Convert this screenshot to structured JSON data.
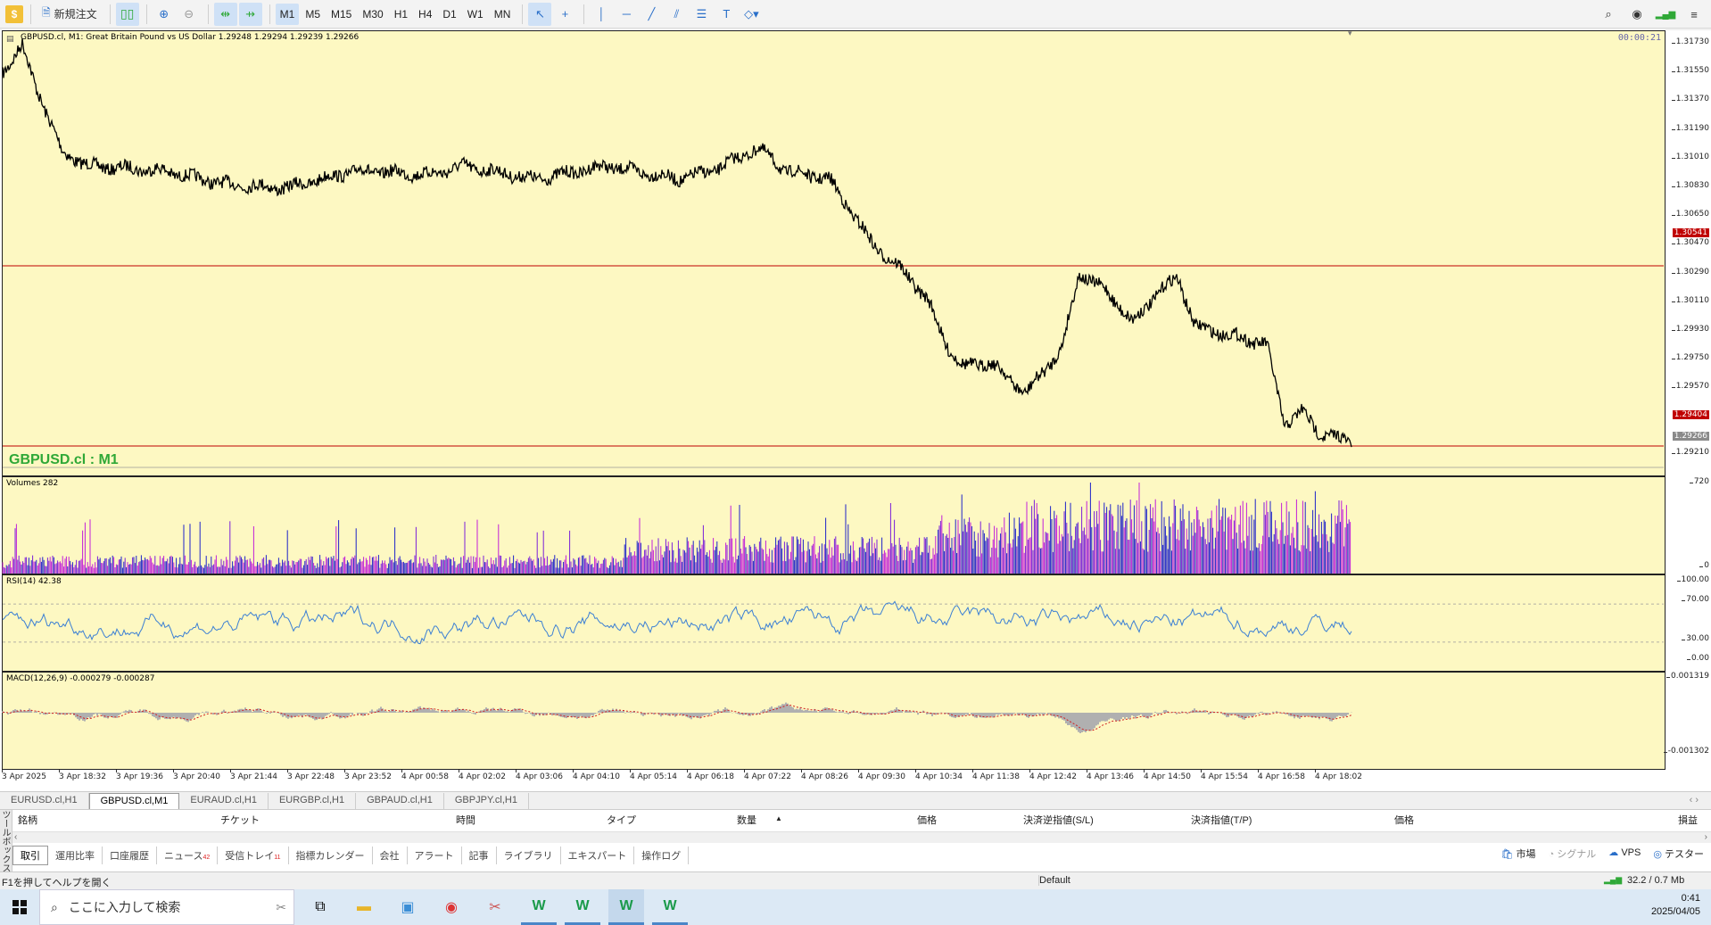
{
  "toolbar": {
    "new_order_label": "新規注文",
    "timeframes": [
      "M1",
      "M5",
      "M15",
      "M30",
      "H1",
      "H4",
      "D1",
      "W1",
      "MN"
    ],
    "active_timeframe": "M1"
  },
  "chart": {
    "title": "GBPUSD.cl, M1:  Great Britain Pound vs US Dollar  1.29248 1.29294 1.29239 1.29266",
    "symbol_label": "GBPUSD.cl : M1",
    "countdown": "00:00:21",
    "background_color": "#fdf8c2",
    "price_axis": [
      "1.31730",
      "1.31550",
      "1.31370",
      "1.31190",
      "1.31010",
      "1.30830",
      "1.30650",
      "1.30470",
      "1.30290",
      "1.30110",
      "1.29930",
      "1.29750",
      "1.29570",
      "1.29210"
    ],
    "price_tags": {
      "upper_line": "1.30541",
      "lower_line": "1.29404",
      "bid": "1.29266"
    },
    "volumes_title": "Volumes 282",
    "volumes_axis": [
      "720",
      "0"
    ],
    "rsi_title": "RSI(14) 42.38",
    "rsi_axis": [
      "100.00",
      "70.00",
      "30.00",
      "0.00"
    ],
    "macd_title": "MACD(12,26,9) -0.000279 -0.000287",
    "macd_axis": [
      "0.001319",
      "-0.001302"
    ],
    "time_axis": [
      "3 Apr 2025",
      "3 Apr 18:32",
      "3 Apr 19:36",
      "3 Apr 20:40",
      "3 Apr 21:44",
      "3 Apr 22:48",
      "3 Apr 23:52",
      "4 Apr 00:58",
      "4 Apr 02:02",
      "4 Apr 03:06",
      "4 Apr 04:10",
      "4 Apr 05:14",
      "4 Apr 06:18",
      "4 Apr 07:22",
      "4 Apr 08:26",
      "4 Apr 09:30",
      "4 Apr 10:34",
      "4 Apr 11:38",
      "4 Apr 12:42",
      "4 Apr 13:46",
      "4 Apr 14:50",
      "4 Apr 15:54",
      "4 Apr 16:58",
      "4 Apr 18:02"
    ],
    "colors": {
      "line": "#000000",
      "hline": "#c00000",
      "rsi": "#3b7fd4",
      "volume": [
        "#7a1fd9",
        "#1d22c9",
        "#c21fd9"
      ],
      "macd_hist": "#b0b0b0",
      "macd_signal": "#d02020"
    }
  },
  "chart_tabs": [
    "EURUSD.cl,H1",
    "GBPUSD.cl,M1",
    "EURAUD.cl,H1",
    "EURGBP.cl,H1",
    "GBPAUD.cl,H1",
    "GBPJPY.cl,H1"
  ],
  "active_chart_tab": "GBPUSD.cl,M1",
  "terminal": {
    "side_label": "ツールボックス",
    "columns": [
      "銘柄",
      "チケット",
      "時間",
      "タイプ",
      "数量",
      "価格",
      "決済逆指値(S/L)",
      "決済指値(T/P)",
      "価格",
      "損益"
    ],
    "tabs": [
      "取引",
      "運用比率",
      "口座履歴",
      "ニュース",
      "受信トレイ",
      "指標カレンダー",
      "会社",
      "アラート",
      "記事",
      "ライブラリ",
      "エキスパート",
      "操作ログ"
    ],
    "news_count": "42",
    "inbox_count": "11",
    "right_items": [
      "市場",
      "シグナル",
      "VPS",
      "テスター"
    ]
  },
  "statusbar": {
    "help": "F1を押してヘルプを開く",
    "profile": "Default",
    "traffic": "32.2 / 0.7 Mb"
  },
  "taskbar": {
    "search_placeholder": "ここに入力して検索",
    "time": "0:41",
    "date": "2025/04/05"
  }
}
